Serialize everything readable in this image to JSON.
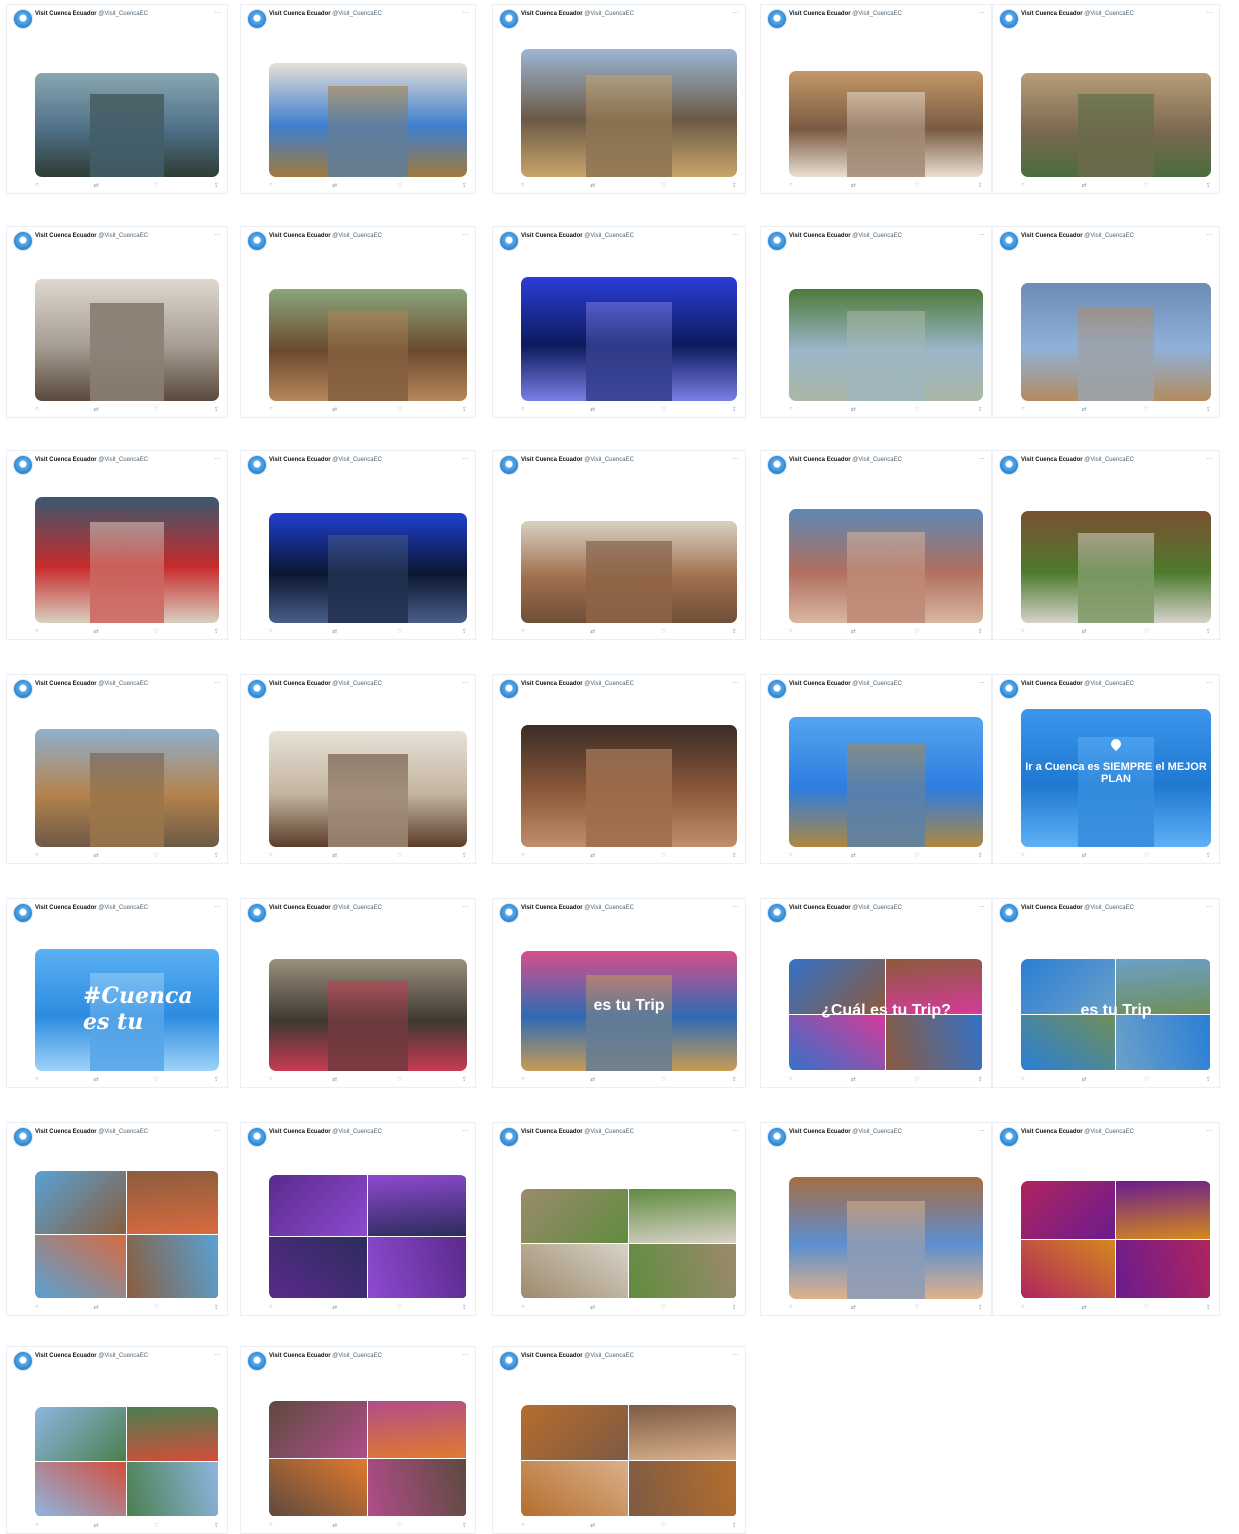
{
  "account": {
    "name": "Visit Cuenca Ecuador",
    "handle": "@Visit_CuencaEC"
  },
  "icons": {
    "reply": "reply-icon",
    "retweet": "retweet-icon",
    "like": "like-icon",
    "share": "share-icon",
    "more": "more-icon"
  },
  "colors": {
    "link": "#1d9bf0",
    "accent": "#2f86d6"
  },
  "tweets": [
    {
      "text": "",
      "tags": "",
      "media": {
        "colors": [
          "#4d6f86",
          "#8aa7b2",
          "#2f3d35"
        ]
      }
    },
    {
      "text": "",
      "tags": "",
      "media": {
        "colors": [
          "#3e7fce",
          "#e4e0d8",
          "#a07a3c"
        ]
      }
    },
    {
      "text": "",
      "tags": "",
      "media": {
        "colors": [
          "#6b5a45",
          "#9bb6d4",
          "#c9a46a"
        ]
      }
    },
    {
      "text": "",
      "tags": "",
      "media": {
        "colors": [
          "#7a5b42",
          "#c49766",
          "#e9dfd3"
        ]
      }
    },
    {
      "text": "",
      "tags": "",
      "media": {
        "colors": [
          "#7c6a52",
          "#b79d78",
          "#4b6b3e"
        ]
      }
    },
    {
      "text": "",
      "tags": "",
      "media": {
        "colors": [
          "#a69d93",
          "#ded8cf",
          "#5b4a3d"
        ]
      }
    },
    {
      "text": "",
      "tags": "",
      "media": {
        "colors": [
          "#6b4a2e",
          "#8aa77b",
          "#b5865a"
        ]
      }
    },
    {
      "text": "",
      "tags": "",
      "media": {
        "colors": [
          "#0d1a5c",
          "#2b3dd8",
          "#7a7fe6"
        ]
      }
    },
    {
      "text": "",
      "tags": "",
      "media": {
        "colors": [
          "#9bb6cc",
          "#4f7a3a",
          "#a9b7a4"
        ]
      }
    },
    {
      "text": "",
      "tags": "",
      "media": {
        "colors": [
          "#8fb1d9",
          "#6c8bb6",
          "#b38b5e"
        ]
      }
    },
    {
      "text": "",
      "tags": "",
      "media": {
        "colors": [
          "#c62b2b",
          "#3b5870",
          "#d9cfc0"
        ]
      }
    },
    {
      "text": "",
      "tags": "",
      "media": {
        "colors": [
          "#0b1730",
          "#1f3fd1",
          "#4a5e8a"
        ]
      }
    },
    {
      "text": "",
      "tags": "",
      "media": {
        "colors": [
          "#a16f4d",
          "#d9d1c4",
          "#6e4f38"
        ]
      }
    },
    {
      "text": "",
      "tags": "",
      "media": {
        "colors": [
          "#b06f5f",
          "#5f88b3",
          "#d8b7a0"
        ]
      }
    },
    {
      "text": "",
      "tags": "",
      "media": {
        "colors": [
          "#4e7a2e",
          "#7a5032",
          "#d5d2cc"
        ]
      }
    },
    {
      "text": "",
      "tags": "",
      "media": {
        "colors": [
          "#b5834d",
          "#8fb0cf",
          "#6d5a46"
        ]
      }
    },
    {
      "text": "",
      "tags": "",
      "media": {
        "colors": [
          "#c2b39e",
          "#e8e2d8",
          "#5a3c2a"
        ]
      }
    },
    {
      "text": "",
      "tags": "",
      "media": {
        "colors": [
          "#8d5a3a",
          "#3a2c26",
          "#c18e6a"
        ]
      }
    },
    {
      "text": "",
      "tags": "",
      "media": {
        "colors": [
          "#2e7de0",
          "#53a4f0",
          "#b0873f"
        ]
      }
    },
    {
      "text": "",
      "tags": "",
      "media": {
        "colors": [
          "#1f78d1",
          "#3b96ec",
          "#5fb0f5"
        ],
        "overlay": "Ir a Cuenca es SIEMPRE el MEJOR PLAN"
      }
    },
    {
      "text": "",
      "tags": "",
      "media": {
        "colors": [
          "#2d8be0",
          "#5bb1f3",
          "#9fd3f8"
        ],
        "overlay": "#Cuenca es tu"
      }
    },
    {
      "text": "",
      "tags": "",
      "media": {
        "colors": [
          "#3f3a32",
          "#9b8f7d",
          "#c73a52"
        ]
      }
    },
    {
      "text": "",
      "tags": "",
      "media": {
        "colors": [
          "#2e6bb5",
          "#d64f8a",
          "#c99b54"
        ],
        "overlay": "es tu Trip"
      }
    },
    {
      "text": "",
      "tags": "",
      "media": {
        "colors": [
          "#3472c9",
          "#8c5a3c",
          "#d43b9a"
        ],
        "overlay": "¿Cuál es tu Trip?"
      }
    },
    {
      "text": "",
      "tags": "",
      "media": {
        "colors": [
          "#2a7fd6",
          "#6ca0c8",
          "#6f8f5a"
        ],
        "overlay": "es tu Trip"
      }
    },
    {
      "text": "",
      "tags": "",
      "media": {
        "colors": [
          "#58a2d4",
          "#8a5d3e",
          "#d96a3f"
        ]
      }
    },
    {
      "text": "",
      "tags": "",
      "media": {
        "colors": [
          "#5a2a8c",
          "#8e4ad0",
          "#2c2c5c"
        ]
      }
    },
    {
      "text": "",
      "tags": "",
      "media": {
        "colors": [
          "#9c8a6c",
          "#5f8c3f",
          "#d8d2c8"
        ]
      }
    },
    {
      "text": "",
      "tags": "",
      "media": {
        "colors": [
          "#5d8fd0",
          "#a56d44",
          "#dfb28a"
        ]
      }
    },
    {
      "text": "",
      "tags": "",
      "media": {
        "colors": [
          "#b0245e",
          "#6a1c8e",
          "#d4891e"
        ]
      }
    },
    {
      "text": "",
      "tags": "",
      "media": {
        "colors": [
          "#8db6e0",
          "#4b7f4f",
          "#d44d3a"
        ]
      }
    },
    {
      "text": "",
      "tags": "",
      "media": {
        "colors": [
          "#5d4a3e",
          "#b04d8a",
          "#e17a2e"
        ]
      }
    },
    {
      "text": "",
      "tags": "",
      "media": {
        "colors": [
          "#b56e2d",
          "#7d5a44",
          "#d9b08a"
        ]
      }
    }
  ]
}
